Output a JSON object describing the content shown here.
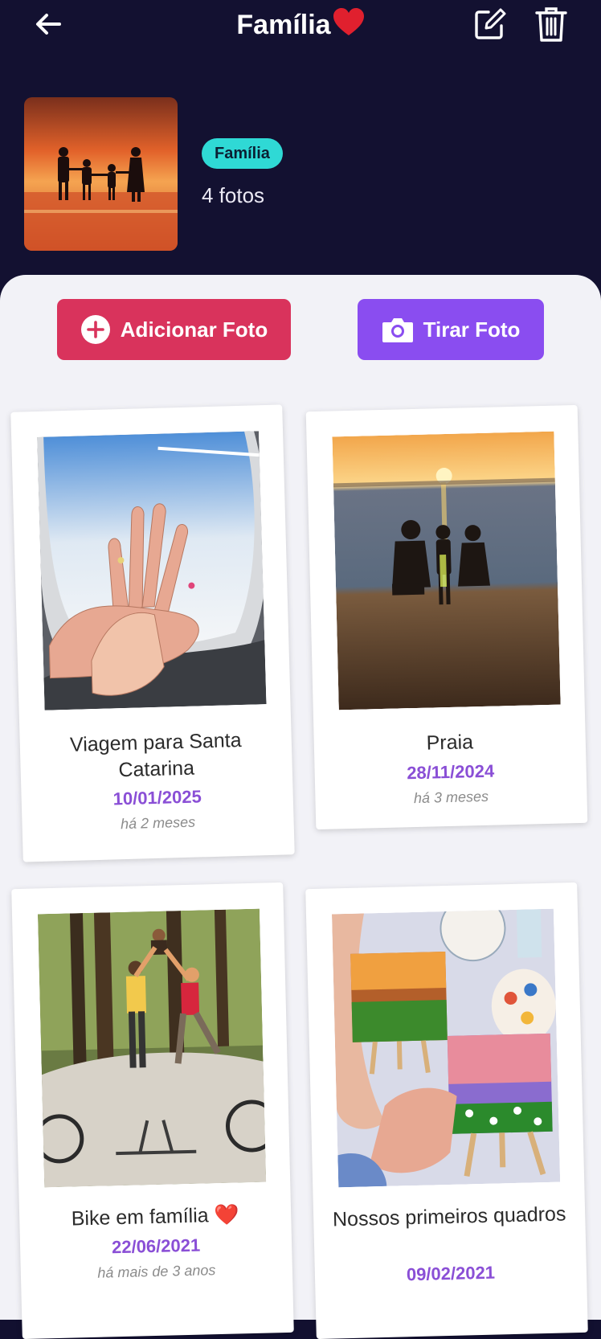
{
  "header": {
    "title": "Família",
    "title_emoji": "❤️",
    "back_icon": "arrow-left-icon",
    "edit_icon": "edit-icon",
    "delete_icon": "trash-icon"
  },
  "album": {
    "tag": "Família",
    "photo_count": "4 fotos"
  },
  "actions": {
    "add_photo": "Adicionar Foto",
    "take_photo": "Tirar Foto"
  },
  "photos": [
    {
      "caption": "Viagem para Santa Catarina",
      "date": "10/01/2025",
      "ago": "há 2 meses"
    },
    {
      "caption": "Praia",
      "date": "28/11/2024",
      "ago": "há 3 meses"
    },
    {
      "caption": "Bike em família ❤️",
      "date": "22/06/2021",
      "ago": "há mais de 3 anos"
    },
    {
      "caption": "Nossos primeiros quadros",
      "date": "09/02/2021",
      "ago": ""
    }
  ],
  "colors": {
    "header_bg": "#131131",
    "add_button": "#d9335c",
    "camera_button": "#8a4df0",
    "tag_bg": "#2fd9d5",
    "date_text": "#8a4fd6"
  }
}
